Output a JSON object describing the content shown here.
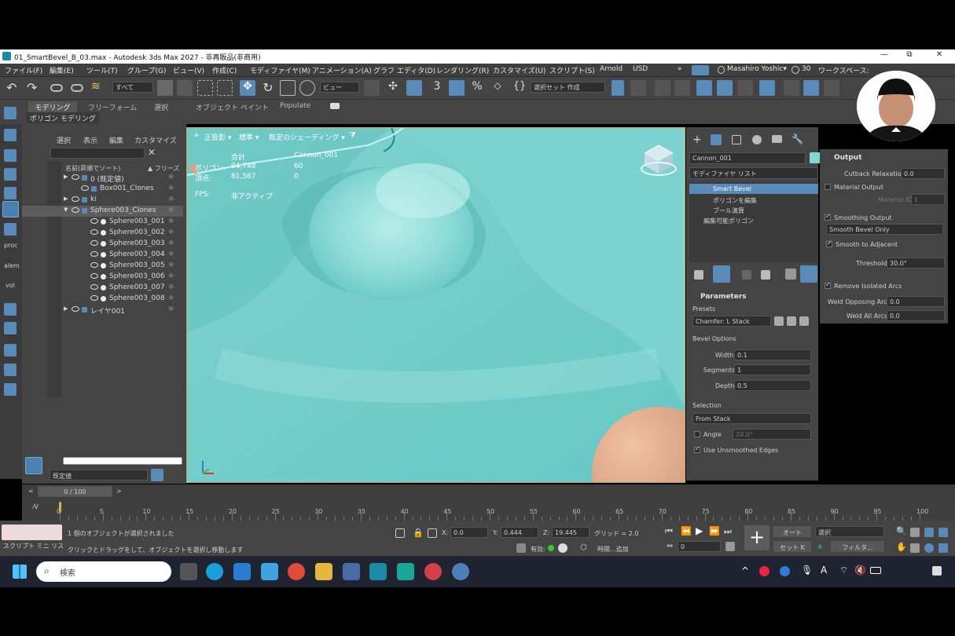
{
  "window": {
    "title": "01_SmartBevel_B_03.max - Autodesk 3ds Max 2027  - 非再販品(非商用)",
    "minimize": "—",
    "maximize": "⧉",
    "close": "✕"
  },
  "menubar": {
    "items": [
      "ファイル(F)",
      "編集(E)",
      "ツール(T)",
      "グループ(G)",
      "ビュー(V)",
      "作成(C)",
      "モディファイヤ(M)",
      "アニメーション(A)",
      "グラフ エディタ(D)",
      "レンダリング(R)",
      "カスタマイズ(U)",
      "スクリプト(S)",
      "Arnold",
      "USD"
    ],
    "overflow": "»",
    "user": "Masahiro Yoshic▾",
    "counter": "30",
    "workspace": "ワークスペース:"
  },
  "toolbar": {
    "filter_dropdown": "すべて",
    "view_dropdown": "ビュー",
    "selection_set": "選択セット 作成"
  },
  "ribbon": {
    "tabs": [
      "モデリング",
      "フリーフォーム",
      "選択",
      "オブジェクト ペイント",
      "Populate"
    ],
    "sub_label": "ポリゴン モデリング"
  },
  "explorer": {
    "menu": [
      "選択",
      "表示",
      "編集",
      "カスタマイズ"
    ],
    "column_name": "名前(昇順でソート)",
    "column_freeze": "▲ フリーズ",
    "rows": [
      {
        "name": "0 (既定値)",
        "indent": 0,
        "expander": "▶",
        "selected": false
      },
      {
        "name": "Box001_Clones",
        "indent": 1,
        "expander": "",
        "selected": false
      },
      {
        "name": "ki",
        "indent": 0,
        "expander": "▶",
        "selected": false
      },
      {
        "name": "Sphere003_Clones",
        "indent": 0,
        "expander": "▼",
        "selected": true
      },
      {
        "name": "Sphere003_001",
        "indent": 2,
        "expander": "",
        "selected": false
      },
      {
        "name": "Sphere003_002",
        "indent": 2,
        "expander": "",
        "selected": false
      },
      {
        "name": "Sphere003_003",
        "indent": 2,
        "expander": "",
        "selected": false
      },
      {
        "name": "Sphere003_004",
        "indent": 2,
        "expander": "",
        "selected": false
      },
      {
        "name": "Sphere003_005",
        "indent": 2,
        "expander": "",
        "selected": false
      },
      {
        "name": "Sphere003_006",
        "indent": 2,
        "expander": "",
        "selected": false
      },
      {
        "name": "Sphere003_007",
        "indent": 2,
        "expander": "",
        "selected": false
      },
      {
        "name": "Sphere003_008",
        "indent": 2,
        "expander": "",
        "selected": false
      },
      {
        "name": "レイヤ001",
        "indent": 0,
        "expander": "▶",
        "selected": false
      }
    ],
    "layer_field": "既定値"
  },
  "viewport": {
    "labels": [
      "+",
      "正投影 ▾",
      "標準 ▾",
      "既定のシェーディング ▾"
    ],
    "stats": {
      "col_total": "合計",
      "col_object": "Cannon_001",
      "poly_label": "ポリゴン:",
      "poly_total": "94,748",
      "poly_object": "60",
      "vert_label": "頂点:",
      "vert_total": "81,567",
      "vert_object": "0",
      "fps_label": "FPS:",
      "fps_value": "非アクティブ"
    },
    "colors": {
      "surface": "#74cfcc",
      "highlight": "#a9e6e3",
      "shadow": "#4fb3b1",
      "sphere": "#d9a282"
    }
  },
  "command_panel": {
    "object_name": "Cannon_001",
    "modifier_list": "モディファイヤ リスト",
    "stack": [
      "Smart Bevel",
      "ポリゴンを編集",
      "ブール演算",
      "編集可能ポリゴン"
    ],
    "parameters": {
      "title": "Parameters",
      "presets_label": "Presets",
      "preset_value": "Chamfer: L Stack",
      "bevel_options": "Bevel Options",
      "width_label": "Width",
      "width_value": "0.1",
      "segments_label": "Segments",
      "segments_value": "1",
      "depth_label": "Depth",
      "depth_value": "0.5",
      "selection": "Selection",
      "selection_value": "From Stack",
      "angle_label": "Angle",
      "angle_value": "20.0°",
      "use_unsmoothed": "Use Unsmoothed Edges"
    },
    "output": {
      "title": "Output",
      "cutback_label": "Cutback Relaxation",
      "cutback_value": "0.0",
      "material_output": "Material Output",
      "material_id_label": "Material ID",
      "material_id_value": "1",
      "smoothing_output": "Smoothing Output",
      "smoothing_value": "Smooth Bevel Only",
      "smooth_adjacent": "Smooth to Adjacent",
      "threshold_label": "Threshold",
      "threshold_value": "30.0°",
      "remove_isolated": "Remove Isolated Arcs",
      "weld_opposing_label": "Weld Opposing Arcs",
      "weld_opposing_value": "0.0",
      "weld_all_label": "Weld All Arcs",
      "weld_all_value": "0.0"
    }
  },
  "timeline": {
    "slider_label": "0 / 100",
    "tick_labels": [
      "0",
      "5",
      "10",
      "15",
      "20",
      "25",
      "30",
      "35",
      "40",
      "45",
      "50",
      "55",
      "60",
      "65",
      "70",
      "75",
      "80",
      "85",
      "90",
      "95",
      "100"
    ]
  },
  "statusbar": {
    "script_tabs": "スクリプト  ミニ  リス",
    "status_line": "1 個のオブジェクトが選択されました",
    "prompt_line": "クリックとドラッグをして、オブジェクトを選択し移動します",
    "x_label": "X:",
    "x_value": "0.0",
    "y_label": "Y:",
    "y_value": "0.444",
    "z_label": "Z:",
    "z_value": "19.445",
    "grid": "グリッド = 2.0",
    "enabled_label": "有効:",
    "time_tag": "時間...追加",
    "frame_value": "0",
    "auto_key": "オート",
    "set_key": "セット K",
    "key_filter_dropdown": "選択",
    "filter_button": "フィルタ..."
  },
  "taskbar": {
    "search_placeholder": "検索"
  }
}
